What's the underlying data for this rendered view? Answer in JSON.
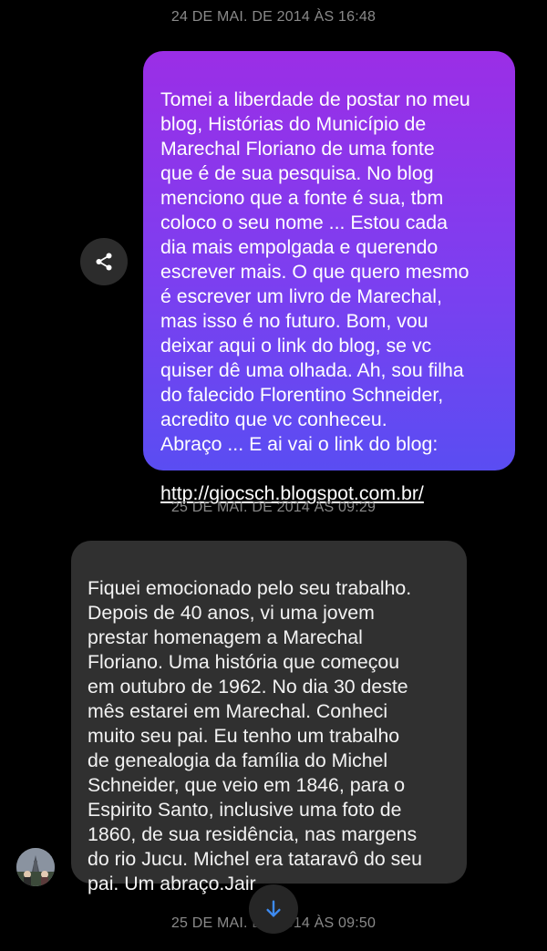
{
  "conversation": {
    "timestamps": [
      "24 DE MAI. DE 2014 ÀS 16:48",
      "25 DE MAI. DE 2014 ÀS 09:29",
      "25 DE MAI. DE 2014 ÀS 09:50"
    ],
    "messages": [
      {
        "direction": "outgoing",
        "text": "Tomei a liberdade de postar no meu\nblog, Histórias do Município de\nMarechal Floriano de uma fonte\nque é de sua pesquisa. No blog\nmenciono que a fonte é sua, tbm\ncoloco o seu nome ... Estou cada\ndia mais empolgada e querendo\nescrever mais. O que quero mesmo\né escrever um livro de Marechal,\nmas isso é no futuro. Bom, vou\ndeixar aqui o link do blog, se vc\nquiser dê uma olhada. Ah, sou filha\ndo falecido Florentino Schneider,\nacredito que vc conheceu.\nAbraço ... E ai vai o link do blog:",
        "link": "http://giocsch.blogspot.com.br/"
      },
      {
        "direction": "incoming",
        "text": "Fiquei emocionado pelo seu trabalho.\nDepois de 40 anos, vi uma jovem\nprestar homenagem a Marechal\nFloriano. Uma história que começou\nem outubro de 1962. No dia 30 deste\nmês estarei em Marechal. Conheci\nmuito seu pai. Eu tenho um trabalho\nde genealogia da família do Michel\nSchneider, que veio em 1846, para o\nEspirito Santo, inclusive uma foto de\n1860, de sua residência, nas margens\ndo rio Jucu. Michel era tataravô do seu\npai. Um abraço.Jair"
      }
    ]
  },
  "icons": {
    "share": "share-icon",
    "scroll_down": "arrow-down-icon",
    "avatar": "contact-avatar"
  },
  "colors": {
    "background": "#000000",
    "outgoing_gradient_top": "#9b2ee6",
    "outgoing_gradient_bottom": "#5a4df2",
    "incoming_bubble": "#303030",
    "timestamp": "#8a8a8a",
    "scroll_arrow": "#3d8bf2"
  }
}
